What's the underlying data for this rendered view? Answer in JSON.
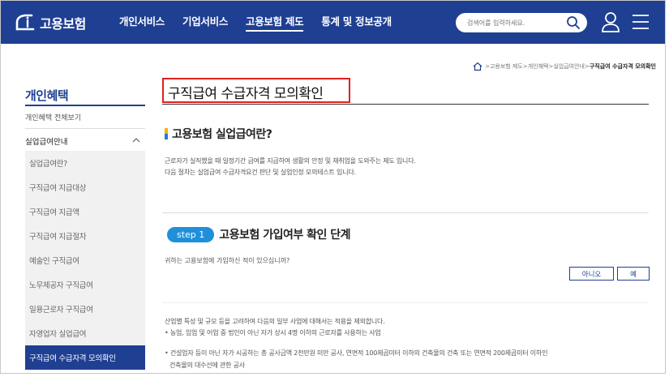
{
  "header": {
    "logo_text": "고용보험",
    "nav": [
      {
        "label": "개인서비스"
      },
      {
        "label": "기업서비스"
      },
      {
        "label": "고용보험 제도"
      },
      {
        "label": "통계 및 정보공개"
      }
    ],
    "search_placeholder": "검색어를 입력하세요."
  },
  "breadcrumb": {
    "items": [
      "고용보험 제도",
      "개인혜택",
      "실업급여안내",
      "구직급여 수급자격 모의확인"
    ],
    "separator": " > "
  },
  "sidebar": {
    "title": "개인혜택",
    "all": "개인혜택 전체보기",
    "section": "실업급여안내",
    "items": [
      "실업급여란?",
      "구직급여 지급대상",
      "구직급여 지급액",
      "구직급여 지급절차",
      "예술인 구직급여",
      "노무제공자 구직급여",
      "일용근로자 구직급여",
      "자영업자 실업급여",
      "구직급여 수급자격 모의확인"
    ]
  },
  "main": {
    "title": "구직급여 수급자격 모의확인",
    "section_title": "고용보험 실업급여란?",
    "desc1": "근로자가 실직했을 때 일정기간 급여를 지급하여 생활의 안정 및 재취업을 도와주는 제도 입니다.",
    "desc2": "다음 절차는 실업급여 수급자격요건 판단 및 실업인정 모의테스트 입니다.",
    "step_badge": "step 1",
    "step_title": "고용보험 가입여부 확인 단계",
    "question": "귀하는 고용보험에 가입하신 적이 있으십니까?",
    "btn_no": "아니오",
    "btn_yes": "예",
    "note1": "산업별 특성 및 규모 등을 고려하여 다음의 일부 사업에 대해서는 적용을 제외합니다.",
    "note2": "• 농업, 임업 및 어업 중 법인이 아닌 자가 상시 4명 이하의 근로자를 사용하는 사업",
    "note3": "• 건설업자 등이 아닌 자가 시공하는 총 공사금액 2천만원 미만 공사, 연면적 100제곱미터 이하의 건축물의 건축 또는 연면적 200제곱미터 이하인",
    "note4": "건축물의 대수선에 관한 공사"
  },
  "colors": {
    "brand": "#1f3f92",
    "step": "#1f8fd9",
    "highlight": "#e02020"
  }
}
